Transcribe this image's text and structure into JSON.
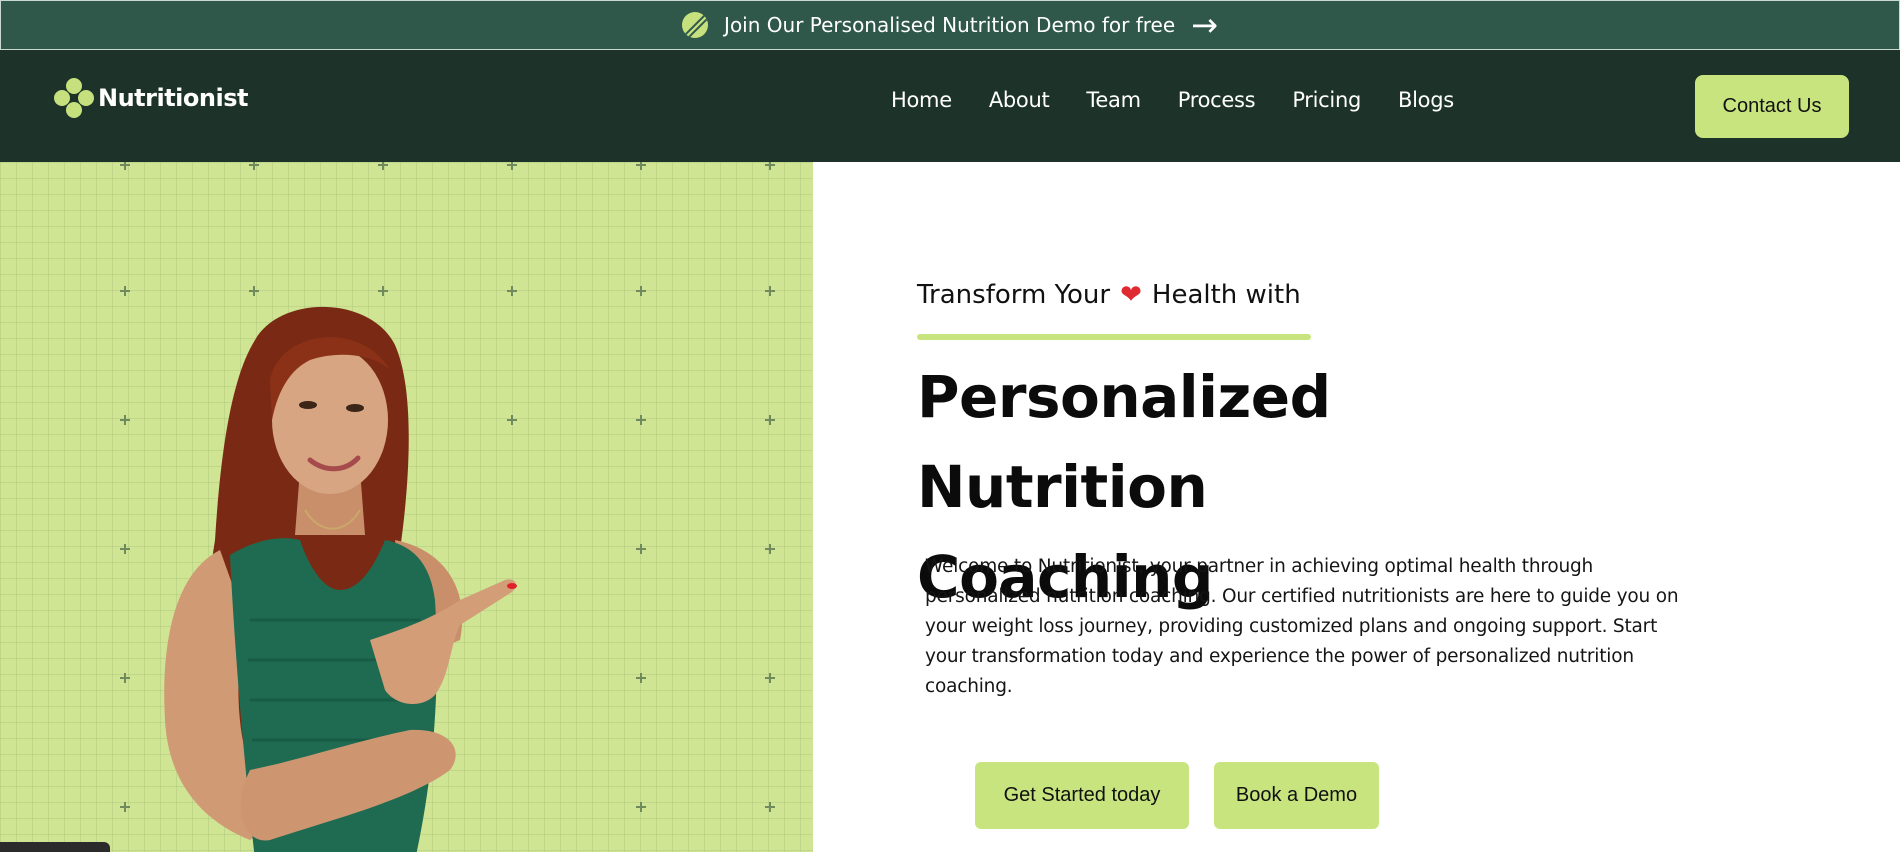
{
  "announcement": {
    "text": "Join Our Personalised Nutrition Demo for free",
    "icon": "leaf-badge-icon",
    "arrow_icon": "arrow-right-icon"
  },
  "nav": {
    "logo_text": "Nutritionist",
    "logo_icon": "flower-logo-icon",
    "items": [
      {
        "label": "Home"
      },
      {
        "label": "About"
      },
      {
        "label": "Team"
      },
      {
        "label": "Process"
      },
      {
        "label": "Pricing"
      },
      {
        "label": "Blogs"
      }
    ],
    "contact_label": "Contact Us"
  },
  "hero": {
    "kicker_start": "Transform Your",
    "kicker_end": "Health with",
    "heart_icon": "heart-icon",
    "title_line1": "Personalized Nutrition",
    "title_line2": "Coaching",
    "intro": "Welcome to Nutritionist, your partner in achieving optimal health through personalized nutrition coaching. Our certified nutritionists are here to guide you on your weight loss journey, providing customized plans and ongoing support. Start your transformation today and experience the power of personalized nutrition coaching.",
    "cta_primary": "Get Started today",
    "cta_secondary": "Book a Demo"
  },
  "colors": {
    "announcement_bg": "#2f584a",
    "nav_bg": "#1d3228",
    "accent": "#c8e47e",
    "hero_left_bg": "#cfe594"
  }
}
